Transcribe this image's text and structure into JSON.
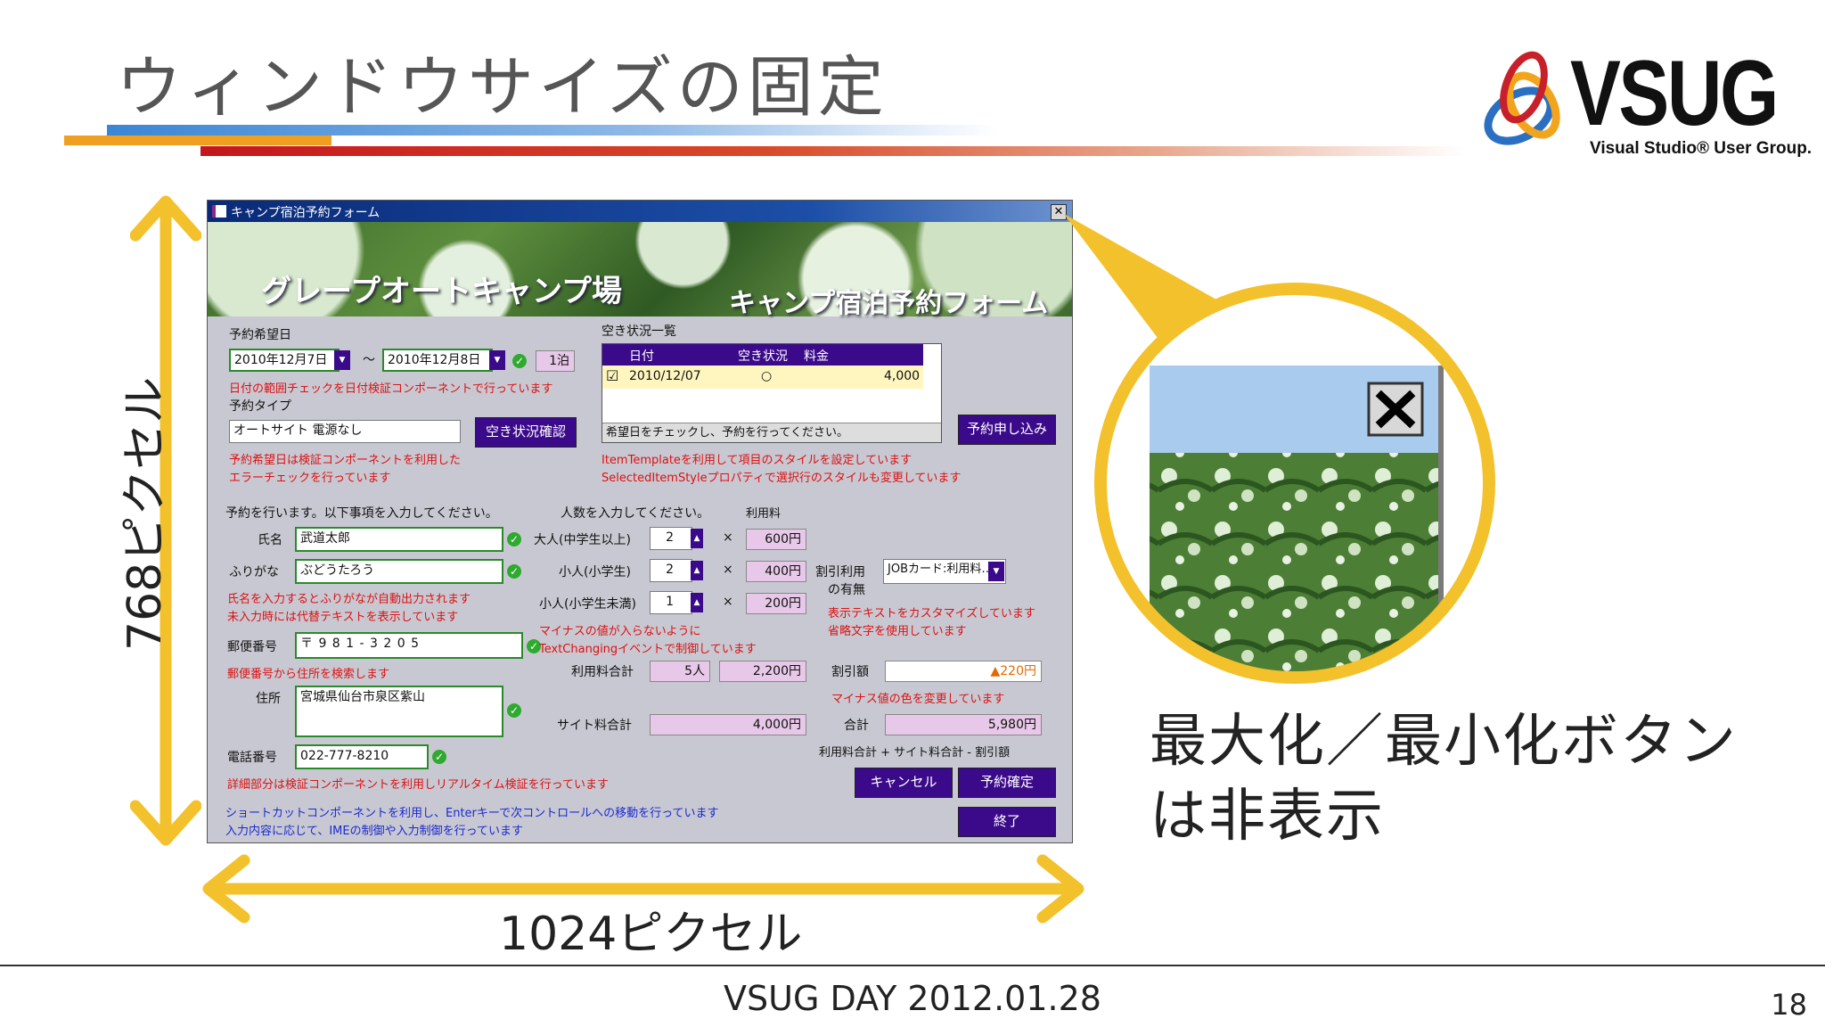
{
  "slide": {
    "title": "ウィンドウサイズの固定",
    "logo_text": "VSUG",
    "logo_subtext": "Visual Studio® User Group.",
    "height_label": "768ピクセル",
    "width_label": "1024ピクセル",
    "callout_line1": "最大化／最小化ボタン",
    "callout_line2": "は非表示",
    "footer": "VSUG DAY 2012.01.28",
    "page_number": "18",
    "colors": {
      "arrow": "#f3c12b",
      "title_bar_blue": "#3a86d6",
      "title_bar_red": "#c4161c",
      "title_bar_orange": "#f0a020"
    }
  },
  "app": {
    "window_title": "キャンプ宿泊予約フォーム",
    "close_glyph": "✕",
    "banner_left": "グレープオートキャンプ場",
    "banner_right": "キャンプ宿泊予約フォーム",
    "reserve_date_label": "予約希望日",
    "date_from": "2010年12月7日",
    "tilde": "～",
    "date_to": "2010年12月8日",
    "nights": "1泊",
    "date_note": "日付の範囲チェックを日付検証コンポーネントで行っています",
    "reserve_type_label": "予約タイプ",
    "reserve_type_value": "オートサイト 電源なし",
    "check_availability_button": "空き状況確認",
    "type_note_1": "予約希望日は検証コンポーネントを利用した",
    "type_note_2": "エラーチェックを行っています",
    "availability_label": "空き状況一覧",
    "grid": {
      "headers": [
        "日付",
        "空き状況",
        "料金"
      ],
      "row": {
        "checked": "☑",
        "date": "2010/12/07",
        "status": "○",
        "price": "4,000"
      },
      "footer": "希望日をチェックし、予約を行ってください。"
    },
    "apply_button": "予約申し込み",
    "grid_note_1": "ItemTemplateを利用して項目のスタイルを設定しています",
    "grid_note_2": "SelectedItemStyleプロパティで選択行のスタイルも変更しています",
    "personal_intro": "予約を行います。以下事項を入力してください。",
    "name_label": "氏名",
    "name_value": "武道太郎",
    "kana_label": "ふりがな",
    "kana_value": "ぶどうたろう",
    "name_note_1": "氏名を入力するとふりがなが自動出力されます",
    "name_note_2": "未入力時には代替テキストを表示しています",
    "zip_label": "郵便番号",
    "zip_value": "〒 9 8 1 - 3 2 0 5",
    "zip_note": "郵便番号から住所を検索します",
    "address_label": "住所",
    "address_value": "宮城県仙台市泉区紫山",
    "phone_label": "電話番号",
    "phone_value": "022-777-8210",
    "detail_note": "詳細部分は検証コンポーネントを利用しリアルタイム検証を行っています",
    "shortcut_note_1": "ショートカットコンポーネントを利用し、Enterキーで次コントロールへの移動を行っています",
    "shortcut_note_2": "入力内容に応じて、IMEの制御や入力制御を行っています",
    "people_intro": "人数を入力してください。",
    "fee_header": "利用料",
    "adult_label": "大人(中学生以上)",
    "adult_count": "2",
    "adult_fee": "600円",
    "child_label": "小人(小学生)",
    "child_count": "2",
    "child_fee": "400円",
    "infant_label": "小人(小学生未満)",
    "infant_count": "1",
    "infant_fee": "200円",
    "times": "×",
    "minus_note_1": "マイナスの値が入らないように",
    "minus_note_2": "TextChangingイベントで制御しています",
    "discount_label_1": "割引利用",
    "discount_label_2": "の有無",
    "discount_value": "JOBカード:利用料…",
    "discount_note_1": "表示テキストをカスタマイズしています",
    "discount_note_2": "省略文字を使用しています",
    "fee_total_label": "利用料合計",
    "fee_total_people": "5人",
    "fee_total_amount": "2,200円",
    "discount_amount_label": "割引額",
    "discount_amount": "▲220円",
    "discount_amount_note": "マイナス値の色を変更しています",
    "site_total_label": "サイト料合計",
    "site_total": "4,000円",
    "grand_total_label": "合計",
    "grand_total": "5,980円",
    "formula": "利用料合計 + サイト料合計 - 割引額",
    "cancel_button": "キャンセル",
    "confirm_button": "予約確定",
    "exit_button": "終了"
  }
}
